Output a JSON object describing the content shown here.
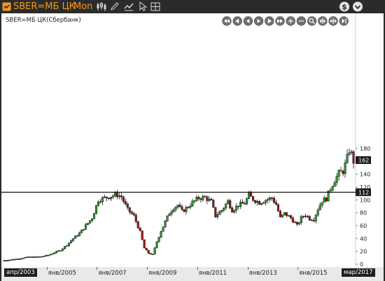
{
  "window": {
    "ticker": "SBER=МБ ЦК",
    "timeframe": "Mon",
    "toolbar": [
      "candles-icon",
      "pencil-icon",
      "tools-icon",
      "cursor-icon",
      "grid-icon"
    ],
    "right_icons": [
      "currency-icon",
      "menu-down-icon"
    ]
  },
  "chart": {
    "header": "SBER=МБ ЦК(Сбербанк)",
    "nav_buttons": [
      "scroll-first-icon",
      "scroll-left-icon",
      "step-left-icon",
      "step-right-icon",
      "scroll-right-icon",
      "scroll-last-icon",
      "zoom-in-icon",
      "zoom-out-icon",
      "zoom-fit-icon",
      "compress-icon",
      "expand-icon",
      "page-end-icon"
    ],
    "current_price_label": "162",
    "horizontal_line_label": "112"
  },
  "chart_data": {
    "type": "candlestick",
    "y_ticks": [
      0,
      20,
      40,
      60,
      80,
      100,
      120,
      140,
      160,
      180
    ],
    "ylim": [
      0,
      190
    ],
    "x_labels": [
      "янв/2005",
      "янв/2007",
      "янв/2009",
      "янв/2011",
      "янв/2013",
      "янв/2015"
    ],
    "start_label": "апр/2003",
    "end_label": "мар/2017",
    "horizontal_line": 112,
    "last_price": 162,
    "colors": {
      "up": "#2e9a2e",
      "down": "#a01818",
      "line": "#000000"
    },
    "price_path": [
      [
        "2003-04",
        6
      ],
      [
        "2003-07",
        7
      ],
      [
        "2003-10",
        8
      ],
      [
        "2004-01",
        10
      ],
      [
        "2004-04",
        11
      ],
      [
        "2004-07",
        11
      ],
      [
        "2004-10",
        12
      ],
      [
        "2005-01",
        14
      ],
      [
        "2005-04",
        18
      ],
      [
        "2005-07",
        22
      ],
      [
        "2005-10",
        30
      ],
      [
        "2006-01",
        40
      ],
      [
        "2006-04",
        48
      ],
      [
        "2006-07",
        60
      ],
      [
        "2006-10",
        72
      ],
      [
        "2007-01",
        100
      ],
      [
        "2007-04",
        103
      ],
      [
        "2007-07",
        106
      ],
      [
        "2007-10",
        108
      ],
      [
        "2007-12",
        105
      ],
      [
        "2008-03",
        85
      ],
      [
        "2008-06",
        75
      ],
      [
        "2008-09",
        50
      ],
      [
        "2008-11",
        25
      ],
      [
        "2009-01",
        17
      ],
      [
        "2009-03",
        15
      ],
      [
        "2009-05",
        35
      ],
      [
        "2009-07",
        52
      ],
      [
        "2009-09",
        66
      ],
      [
        "2009-11",
        80
      ],
      [
        "2010-01",
        88
      ],
      [
        "2010-03",
        92
      ],
      [
        "2010-05",
        82
      ],
      [
        "2010-07",
        87
      ],
      [
        "2010-10",
        96
      ],
      [
        "2011-01",
        103
      ],
      [
        "2011-04",
        104
      ],
      [
        "2011-07",
        97
      ],
      [
        "2011-09",
        75
      ],
      [
        "2011-12",
        84
      ],
      [
        "2012-03",
        98
      ],
      [
        "2012-05",
        84
      ],
      [
        "2012-08",
        92
      ],
      [
        "2012-11",
        95
      ],
      [
        "2013-01",
        107
      ],
      [
        "2013-03",
        101
      ],
      [
        "2013-06",
        96
      ],
      [
        "2013-09",
        100
      ],
      [
        "2013-12",
        103
      ],
      [
        "2014-02",
        93
      ],
      [
        "2014-04",
        72
      ],
      [
        "2014-06",
        79
      ],
      [
        "2014-09",
        72
      ],
      [
        "2014-12",
        60
      ],
      [
        "2015-02",
        72
      ],
      [
        "2015-04",
        77
      ],
      [
        "2015-06",
        71
      ],
      [
        "2015-08",
        70
      ],
      [
        "2015-10",
        86
      ],
      [
        "2015-12",
        99
      ],
      [
        "2016-02",
        102
      ],
      [
        "2016-04",
        118
      ],
      [
        "2016-06",
        131
      ],
      [
        "2016-08",
        141
      ],
      [
        "2016-10",
        145
      ],
      [
        "2016-12",
        165
      ],
      [
        "2017-01",
        178
      ],
      [
        "2017-02",
        171
      ],
      [
        "2017-03",
        160
      ]
    ]
  }
}
